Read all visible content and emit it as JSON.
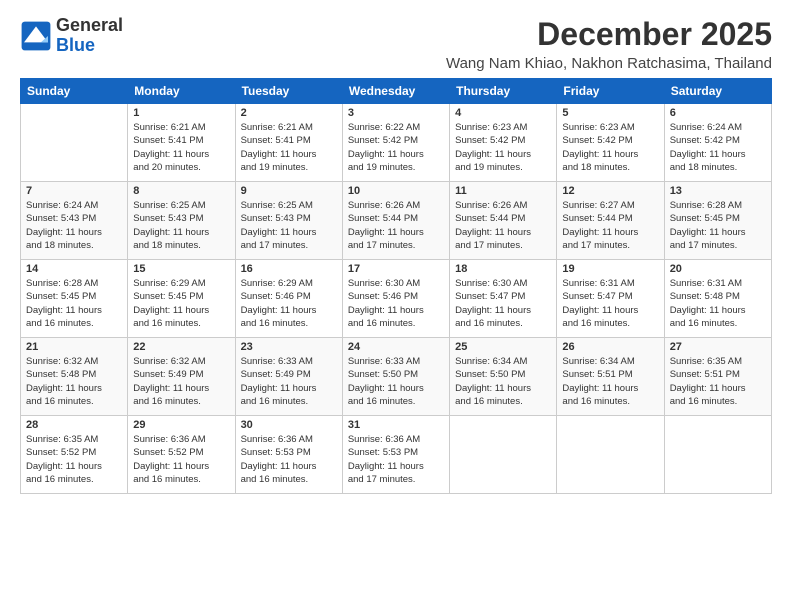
{
  "header": {
    "logo_line1": "General",
    "logo_line2": "Blue",
    "title": "December 2025",
    "subtitle": "Wang Nam Khiao, Nakhon Ratchasima, Thailand"
  },
  "weekdays": [
    "Sunday",
    "Monday",
    "Tuesday",
    "Wednesday",
    "Thursday",
    "Friday",
    "Saturday"
  ],
  "weeks": [
    [
      {
        "day": "",
        "info": ""
      },
      {
        "day": "1",
        "info": "Sunrise: 6:21 AM\nSunset: 5:41 PM\nDaylight: 11 hours\nand 20 minutes."
      },
      {
        "day": "2",
        "info": "Sunrise: 6:21 AM\nSunset: 5:41 PM\nDaylight: 11 hours\nand 19 minutes."
      },
      {
        "day": "3",
        "info": "Sunrise: 6:22 AM\nSunset: 5:42 PM\nDaylight: 11 hours\nand 19 minutes."
      },
      {
        "day": "4",
        "info": "Sunrise: 6:23 AM\nSunset: 5:42 PM\nDaylight: 11 hours\nand 19 minutes."
      },
      {
        "day": "5",
        "info": "Sunrise: 6:23 AM\nSunset: 5:42 PM\nDaylight: 11 hours\nand 18 minutes."
      },
      {
        "day": "6",
        "info": "Sunrise: 6:24 AM\nSunset: 5:42 PM\nDaylight: 11 hours\nand 18 minutes."
      }
    ],
    [
      {
        "day": "7",
        "info": "Sunrise: 6:24 AM\nSunset: 5:43 PM\nDaylight: 11 hours\nand 18 minutes."
      },
      {
        "day": "8",
        "info": "Sunrise: 6:25 AM\nSunset: 5:43 PM\nDaylight: 11 hours\nand 18 minutes."
      },
      {
        "day": "9",
        "info": "Sunrise: 6:25 AM\nSunset: 5:43 PM\nDaylight: 11 hours\nand 17 minutes."
      },
      {
        "day": "10",
        "info": "Sunrise: 6:26 AM\nSunset: 5:44 PM\nDaylight: 11 hours\nand 17 minutes."
      },
      {
        "day": "11",
        "info": "Sunrise: 6:26 AM\nSunset: 5:44 PM\nDaylight: 11 hours\nand 17 minutes."
      },
      {
        "day": "12",
        "info": "Sunrise: 6:27 AM\nSunset: 5:44 PM\nDaylight: 11 hours\nand 17 minutes."
      },
      {
        "day": "13",
        "info": "Sunrise: 6:28 AM\nSunset: 5:45 PM\nDaylight: 11 hours\nand 17 minutes."
      }
    ],
    [
      {
        "day": "14",
        "info": "Sunrise: 6:28 AM\nSunset: 5:45 PM\nDaylight: 11 hours\nand 16 minutes."
      },
      {
        "day": "15",
        "info": "Sunrise: 6:29 AM\nSunset: 5:45 PM\nDaylight: 11 hours\nand 16 minutes."
      },
      {
        "day": "16",
        "info": "Sunrise: 6:29 AM\nSunset: 5:46 PM\nDaylight: 11 hours\nand 16 minutes."
      },
      {
        "day": "17",
        "info": "Sunrise: 6:30 AM\nSunset: 5:46 PM\nDaylight: 11 hours\nand 16 minutes."
      },
      {
        "day": "18",
        "info": "Sunrise: 6:30 AM\nSunset: 5:47 PM\nDaylight: 11 hours\nand 16 minutes."
      },
      {
        "day": "19",
        "info": "Sunrise: 6:31 AM\nSunset: 5:47 PM\nDaylight: 11 hours\nand 16 minutes."
      },
      {
        "day": "20",
        "info": "Sunrise: 6:31 AM\nSunset: 5:48 PM\nDaylight: 11 hours\nand 16 minutes."
      }
    ],
    [
      {
        "day": "21",
        "info": "Sunrise: 6:32 AM\nSunset: 5:48 PM\nDaylight: 11 hours\nand 16 minutes."
      },
      {
        "day": "22",
        "info": "Sunrise: 6:32 AM\nSunset: 5:49 PM\nDaylight: 11 hours\nand 16 minutes."
      },
      {
        "day": "23",
        "info": "Sunrise: 6:33 AM\nSunset: 5:49 PM\nDaylight: 11 hours\nand 16 minutes."
      },
      {
        "day": "24",
        "info": "Sunrise: 6:33 AM\nSunset: 5:50 PM\nDaylight: 11 hours\nand 16 minutes."
      },
      {
        "day": "25",
        "info": "Sunrise: 6:34 AM\nSunset: 5:50 PM\nDaylight: 11 hours\nand 16 minutes."
      },
      {
        "day": "26",
        "info": "Sunrise: 6:34 AM\nSunset: 5:51 PM\nDaylight: 11 hours\nand 16 minutes."
      },
      {
        "day": "27",
        "info": "Sunrise: 6:35 AM\nSunset: 5:51 PM\nDaylight: 11 hours\nand 16 minutes."
      }
    ],
    [
      {
        "day": "28",
        "info": "Sunrise: 6:35 AM\nSunset: 5:52 PM\nDaylight: 11 hours\nand 16 minutes."
      },
      {
        "day": "29",
        "info": "Sunrise: 6:36 AM\nSunset: 5:52 PM\nDaylight: 11 hours\nand 16 minutes."
      },
      {
        "day": "30",
        "info": "Sunrise: 6:36 AM\nSunset: 5:53 PM\nDaylight: 11 hours\nand 16 minutes."
      },
      {
        "day": "31",
        "info": "Sunrise: 6:36 AM\nSunset: 5:53 PM\nDaylight: 11 hours\nand 17 minutes."
      },
      {
        "day": "",
        "info": ""
      },
      {
        "day": "",
        "info": ""
      },
      {
        "day": "",
        "info": ""
      }
    ]
  ]
}
